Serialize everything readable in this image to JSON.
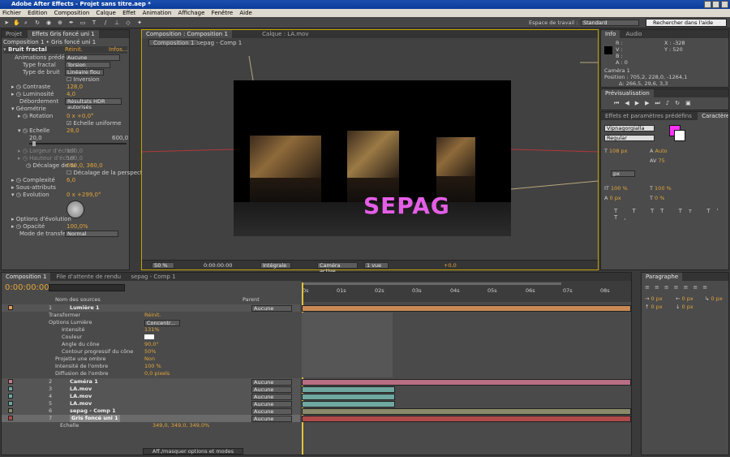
{
  "window": {
    "title": "Adobe After Effects - Projet sans titre.aep *"
  },
  "menu": [
    "Fichier",
    "Edition",
    "Composition",
    "Calque",
    "Effet",
    "Animation",
    "Affichage",
    "Fenêtre",
    "Aide"
  ],
  "toolbar": {
    "workspace_label": "Espace de travail :",
    "workspace_value": "Standard",
    "search_placeholder": "Rechercher dans l'aide"
  },
  "left_panel": {
    "tabs": [
      "Projet",
      "Effets Gris foncé uni 1"
    ],
    "header": "Composition 1 • Gris foncé uni 1",
    "effect_name": "Bruit fractal",
    "reset": "Réinit.",
    "info": "Infos...",
    "props": [
      {
        "label": "Animations prédéfinies",
        "value": "Aucune"
      },
      {
        "label": "Type fractal",
        "value": "Torsion dynamique"
      },
      {
        "label": "Type de bruit",
        "value": "Linéaire flou"
      },
      {
        "label": "",
        "value": "Inversion"
      },
      {
        "label": "Contraste",
        "value": "128,0"
      },
      {
        "label": "Luminosité",
        "value": "4,0"
      },
      {
        "label": "Débordement",
        "value": "Résultats HDR autorisés"
      },
      {
        "label": "Géométrie",
        "value": ""
      },
      {
        "label": "Rotation",
        "value": "0 x +0,0°"
      },
      {
        "label": "",
        "value": "Echelle uniforme"
      },
      {
        "label": "Echelle",
        "value": "28,0"
      },
      {
        "label": "20,0",
        "value": "600,0"
      },
      {
        "label": "Largeur d'échell",
        "value": "100,0"
      },
      {
        "label": "Hauteur d'échel",
        "value": "100,0"
      },
      {
        "label": "Décalage de tu",
        "value": "640,0, 360,0"
      },
      {
        "label": "",
        "value": "Décalage de la perspective"
      },
      {
        "label": "Complexité",
        "value": "6,0"
      },
      {
        "label": "Sous-attributs",
        "value": ""
      },
      {
        "label": "Evolution",
        "value": "0 x +299,0°"
      },
      {
        "label": "Options d'évolution",
        "value": ""
      },
      {
        "label": "Opacité",
        "value": "100,0%"
      },
      {
        "label": "Mode de transfert",
        "value": "Normal"
      }
    ]
  },
  "viewer": {
    "tabs": [
      "Composition : Composition 1",
      "Calque : LA.mov"
    ],
    "subtabs": [
      "Composition 1",
      "sepag - Comp 1"
    ],
    "overlay_text": "SEPAG",
    "footer": {
      "zoom": "50 %",
      "time": "0:00:00:00",
      "quality": "Intégrale",
      "camera": "Caméra active",
      "views": "1 vue",
      "offset": "+0,0"
    }
  },
  "info_panel": {
    "tabs": [
      "Info",
      "Audio"
    ],
    "rgba": [
      "R :",
      "V :",
      "B :",
      "A : 0"
    ],
    "coords": [
      "X : -328",
      "Y : 520"
    ],
    "camera": "Caméra 1",
    "position": "Position : 705,2, 228,0, -1264,1",
    "delta": "Δ: 266,5, 29,6, 3,3"
  },
  "preview_panel": {
    "title": "Prévisualisation"
  },
  "character_panel": {
    "tabs": [
      "Effets et paramètres prédéfins",
      "Caractère"
    ],
    "font": "Vipnagorgialla",
    "style": "Regular",
    "size": "108 px",
    "leading": "Auto",
    "tracking": "75",
    "kerning_unit": "px",
    "vscale": "100 %",
    "hscale": "100 %",
    "baseline": "0 px",
    "tsume": "0 %",
    "accent_color": "#ff33ff"
  },
  "paragraph_panel": {
    "title": "Paragraphe",
    "fields": [
      "0 px",
      "0 px",
      "0 px",
      "0 px",
      "0 px"
    ]
  },
  "timeline": {
    "tabs": [
      "Composition 1",
      "File d'attente de rendu",
      "sepag - Comp 1"
    ],
    "time": "0:00:00:00",
    "col_source": "Nom des sources",
    "col_parent": "Parent",
    "ruler": [
      "0s",
      "01s",
      "02s",
      "03s",
      "04s",
      "05s",
      "06s",
      "07s",
      "08s"
    ],
    "rows": [
      {
        "num": "1",
        "name": "Lumière 1",
        "parent": "Aucune",
        "kind": "layer",
        "color": "#e39b5a"
      },
      {
        "num": "",
        "name": "Transformer",
        "value": "Réinit.",
        "kind": "prop"
      },
      {
        "num": "",
        "name": "Options Lumière",
        "value": "Concentr...",
        "kind": "prop"
      },
      {
        "num": "",
        "name": "Intensité",
        "value": "131%",
        "kind": "sub"
      },
      {
        "num": "",
        "name": "Couleur",
        "value": "",
        "kind": "sub"
      },
      {
        "num": "",
        "name": "Angle du cône",
        "value": "90,0°",
        "kind": "sub"
      },
      {
        "num": "",
        "name": "Contour progressif du cône",
        "value": "50%",
        "kind": "sub"
      },
      {
        "num": "",
        "name": "Projette une ombre",
        "value": "Non",
        "kind": "sub"
      },
      {
        "num": "",
        "name": "Intensité de l'ombre",
        "value": "100 %",
        "kind": "sub"
      },
      {
        "num": "",
        "name": "Diffusion de l'ombre",
        "value": "0,0 pixels",
        "kind": "sub"
      },
      {
        "num": "2",
        "name": "Caméra 1",
        "parent": "Aucune",
        "kind": "layer",
        "color": "#c97a8e"
      },
      {
        "num": "3",
        "name": "LA.mov",
        "parent": "Aucune",
        "kind": "layer",
        "color": "#6fa8a0"
      },
      {
        "num": "4",
        "name": "LA.mov",
        "parent": "Aucune",
        "kind": "layer",
        "color": "#6fa8a0"
      },
      {
        "num": "5",
        "name": "LA.mov",
        "parent": "Aucune",
        "kind": "layer",
        "color": "#6fa8a0"
      },
      {
        "num": "6",
        "name": "sepag - Comp 1",
        "parent": "Aucune",
        "kind": "layer",
        "color": "#8a8a6a"
      },
      {
        "num": "7",
        "name": "Gris foncé uni 1",
        "parent": "Aucune",
        "kind": "layer",
        "color": "#b04a4a"
      },
      {
        "num": "",
        "name": "Echelle",
        "value": "349,0, 349,0, 349,0%",
        "kind": "prop"
      }
    ],
    "footer": "Aff./masquer options et modes"
  }
}
